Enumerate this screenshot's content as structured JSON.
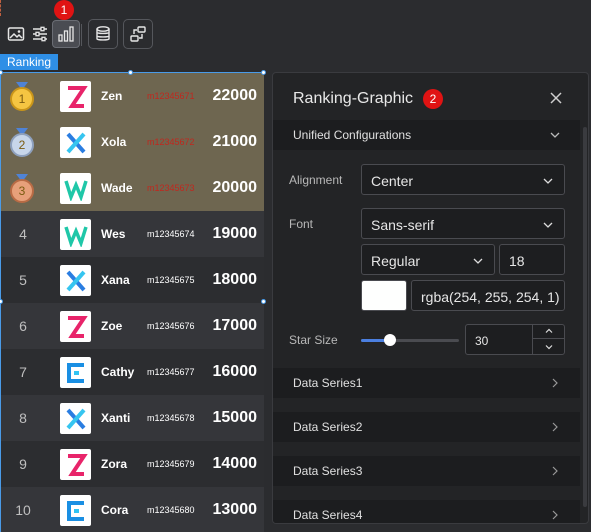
{
  "colors": {
    "accent_blue": "#2f8fe6",
    "marker_red": "#e01313",
    "top_row_bg": "#6e6650",
    "panel_bg": "#232426",
    "swatch_color": "#fefffe"
  },
  "toolbar": {
    "buttons": [
      {
        "icon": "image-icon"
      },
      {
        "icon": "sliders-icon"
      },
      {
        "icon": "bar-chart-icon"
      },
      {
        "icon": "database-icon"
      },
      {
        "icon": "swap-icon"
      }
    ],
    "marker_1": "1"
  },
  "component_tag": "Ranking",
  "ranking": {
    "rows": [
      {
        "rank": "1",
        "name": "Zen",
        "code": "m12345671",
        "score": "22000",
        "logo": "Z",
        "medal": "gold",
        "code_red": true
      },
      {
        "rank": "2",
        "name": "Xola",
        "code": "m12345672",
        "score": "21000",
        "logo": "X",
        "medal": "silver",
        "code_red": true
      },
      {
        "rank": "3",
        "name": "Wade",
        "code": "m12345673",
        "score": "20000",
        "logo": "W",
        "medal": "bronze",
        "code_red": true
      },
      {
        "rank": "4",
        "name": "Wes",
        "code": "m12345674",
        "score": "19000",
        "logo": "W",
        "medal": "",
        "code_red": false
      },
      {
        "rank": "5",
        "name": "Xana",
        "code": "m12345675",
        "score": "18000",
        "logo": "X",
        "medal": "",
        "code_red": false
      },
      {
        "rank": "6",
        "name": "Zoe",
        "code": "m12345676",
        "score": "17000",
        "logo": "Z",
        "medal": "",
        "code_red": false
      },
      {
        "rank": "7",
        "name": "Cathy",
        "code": "m12345677",
        "score": "16000",
        "logo": "C",
        "medal": "",
        "code_red": false
      },
      {
        "rank": "8",
        "name": "Xanti",
        "code": "m12345678",
        "score": "15000",
        "logo": "X",
        "medal": "",
        "code_red": false
      },
      {
        "rank": "9",
        "name": "Zora",
        "code": "m12345679",
        "score": "14000",
        "logo": "Z",
        "medal": "",
        "code_red": false
      },
      {
        "rank": "10",
        "name": "Cora",
        "code": "m12345680",
        "score": "13000",
        "logo": "C",
        "medal": "",
        "code_red": false
      }
    ]
  },
  "panel": {
    "title": "Ranking-Graphic",
    "marker_2": "2",
    "unified_section": "Unified Configurations",
    "alignment_label": "Alignment",
    "alignment_value": "Center",
    "font_label": "Font",
    "font_family_value": "Sans-serif",
    "font_weight_value": "Regular",
    "font_size_value": "18",
    "font_color_value": "rgba(254, 255, 254, 1)",
    "star_size_label": "Star Size",
    "star_size_value": "30",
    "star_size_fraction": 0.3,
    "series": [
      "Data Series1",
      "Data Series2",
      "Data Series3",
      "Data Series4"
    ]
  }
}
